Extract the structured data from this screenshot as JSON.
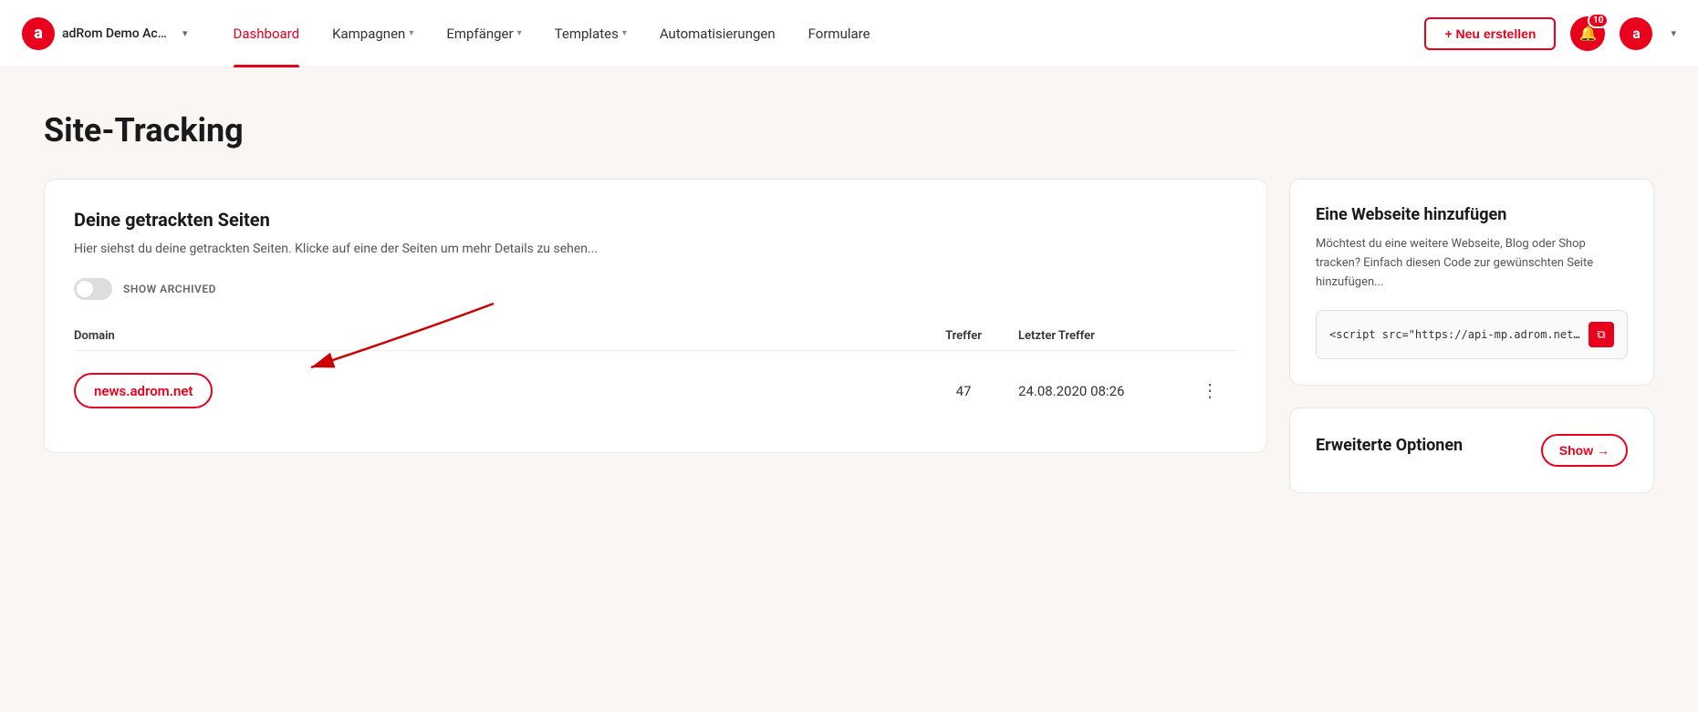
{
  "brand": {
    "logo_letter": "a",
    "account_name": "adRom Demo Acc...",
    "logo_color": "#e8001c"
  },
  "nav": {
    "links": [
      {
        "id": "dashboard",
        "label": "Dashboard",
        "active": true,
        "has_dropdown": false
      },
      {
        "id": "kampagnen",
        "label": "Kampagnen",
        "active": false,
        "has_dropdown": true
      },
      {
        "id": "empfanger",
        "label": "Empfänger",
        "active": false,
        "has_dropdown": true
      },
      {
        "id": "templates",
        "label": "Templates",
        "active": false,
        "has_dropdown": true
      },
      {
        "id": "automatisierungen",
        "label": "Automatisierungen",
        "active": false,
        "has_dropdown": false
      },
      {
        "id": "formulare",
        "label": "Formulare",
        "active": false,
        "has_dropdown": false
      }
    ],
    "new_button": "+ Neu erstellen",
    "notification_count": "10",
    "user_letter": "a"
  },
  "page": {
    "title": "Site-Tracking"
  },
  "left_card": {
    "title": "Deine getrackten Seiten",
    "description": "Hier siehst du deine getrackten Seiten. Klicke auf eine der Seiten um mehr Details zu sehen...",
    "toggle_label": "SHOW ARCHIVED",
    "table": {
      "columns": [
        "Domain",
        "Treffer",
        "Letzter Treffer",
        ""
      ],
      "rows": [
        {
          "domain": "news.adrom.net",
          "treffer": "47",
          "letzter_treffer": "24.08.2020 08:26"
        }
      ]
    }
  },
  "right_cards": {
    "add_website": {
      "title": "Eine Webseite hinzufügen",
      "description": "Möchtest du eine weitere Webseite, Blog oder Shop tracken? Einfach diesen Code zur gewünschten Seite hinzufügen...",
      "script_text": "<script src=\"https://api-mp.adrom.net/tracker?am"
    },
    "erweiterte": {
      "title": "Erweiterte Optionen",
      "show_label": "Show →"
    }
  }
}
